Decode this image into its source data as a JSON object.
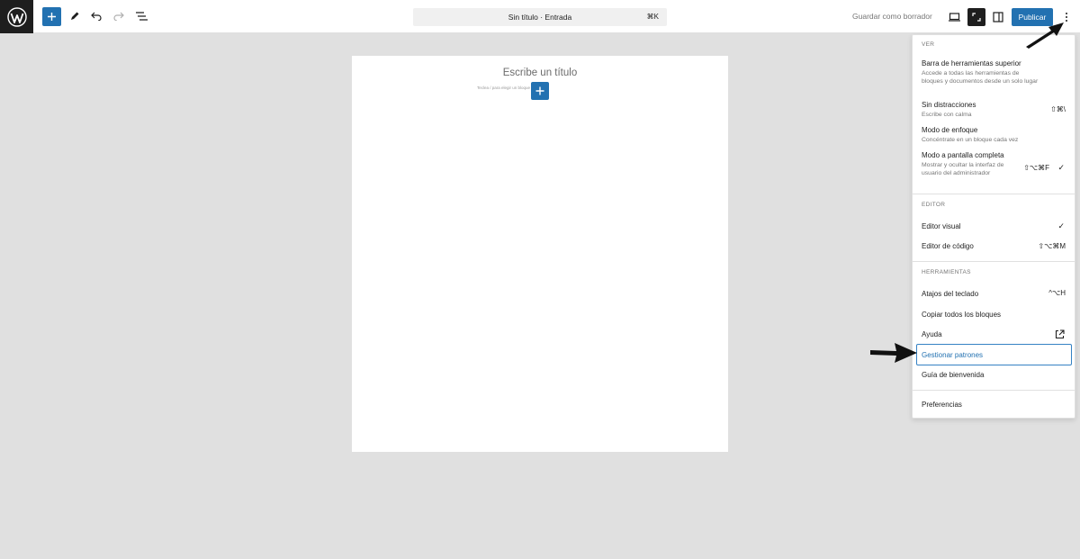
{
  "topbar": {
    "logo_icon": "wordpress-logo",
    "doc_title": "Sin título · Entrada",
    "doc_shortcut": "⌘K",
    "save_draft": "Guardar como borrador",
    "publish": "Publicar",
    "icons": [
      "plus-icon",
      "pen-icon",
      "undo-icon",
      "redo-icon",
      "list-view-icon",
      "desktop-icon",
      "fullscreen-icon",
      "sidebar-icon",
      "more-vertical-icon"
    ]
  },
  "canvas": {
    "title_placeholder": "Escribe un título",
    "block_placeholder": "Teclea / para elegir un bloque"
  },
  "menu": {
    "sections": {
      "ver": "VER",
      "editor": "EDITOR",
      "herramientas": "HERRAMIENTAS"
    },
    "ver_items": [
      {
        "label": "Barra de herramientas superior",
        "desc": "Accede a todas las herramientas de bloques y documentos desde un solo lugar",
        "shortcut": ""
      },
      {
        "label": "Sin distracciones",
        "desc": "Escribe con calma",
        "shortcut": "⇧⌘\\"
      },
      {
        "label": "Modo de enfoque",
        "desc": "Concéntrate en un bloque cada vez",
        "shortcut": ""
      },
      {
        "label": "Modo a pantalla completa",
        "desc": "Mostrar y ocultar la interfaz de usuario del administrador",
        "shortcut": "⇧⌥⌘F",
        "checked": true
      }
    ],
    "editor_items": [
      {
        "label": "Editor visual",
        "checked": true
      },
      {
        "label": "Editor de código",
        "shortcut": "⇧⌥⌘M"
      }
    ],
    "tool_items": [
      {
        "label": "Atajos del teclado",
        "shortcut": "^⌥H"
      },
      {
        "label": "Copiar todos los bloques"
      },
      {
        "label": "Ayuda",
        "icon": "external-link-icon"
      },
      {
        "label": "Gestionar patrones",
        "highlighted": true
      },
      {
        "label": "Guía de bienvenida"
      }
    ],
    "preferences": "Preferencias",
    "check_mark": "✓"
  }
}
